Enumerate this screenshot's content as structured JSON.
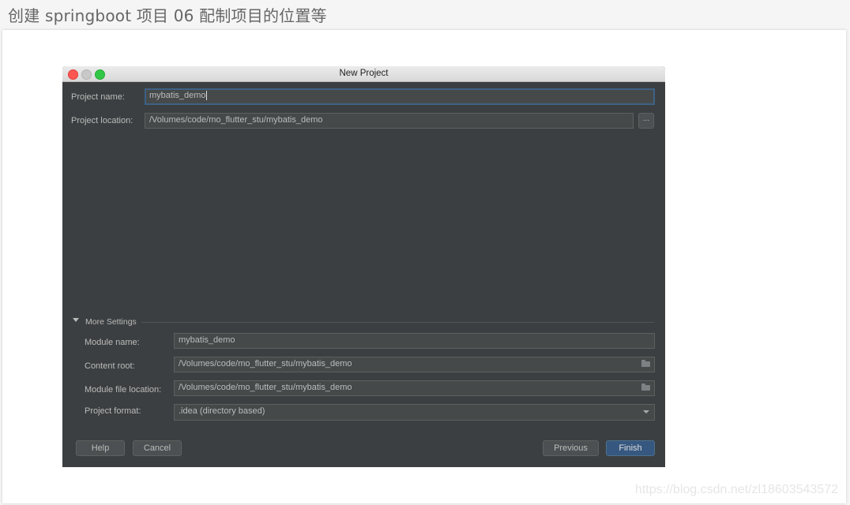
{
  "page": {
    "title": "创建 springboot 项目 06 配制项目的位置等",
    "watermark": "https://blog.csdn.net/zl18603543572"
  },
  "dialog": {
    "window_title": "New Project",
    "project_name": {
      "label": "Project name:",
      "value": "mybatis_demo"
    },
    "project_location": {
      "label": "Project location:",
      "value": "/Volumes/code/mo_flutter_stu/mybatis_demo",
      "browse_label": "..."
    },
    "more_settings": {
      "title": "More Settings",
      "module_name": {
        "label": "Module name:",
        "value": "mybatis_demo"
      },
      "content_root": {
        "label": "Content root:",
        "value": "/Volumes/code/mo_flutter_stu/mybatis_demo"
      },
      "module_file_location": {
        "label": "Module file location:",
        "value": "/Volumes/code/mo_flutter_stu/mybatis_demo"
      },
      "project_format": {
        "label": "Project format:",
        "selected": ".idea (directory based)"
      }
    },
    "buttons": {
      "help": "Help",
      "cancel": "Cancel",
      "previous": "Previous",
      "finish": "Finish"
    },
    "colors": {
      "background": "#3c3f41",
      "accent": "#365880",
      "focus_border": "#3d6185"
    }
  }
}
